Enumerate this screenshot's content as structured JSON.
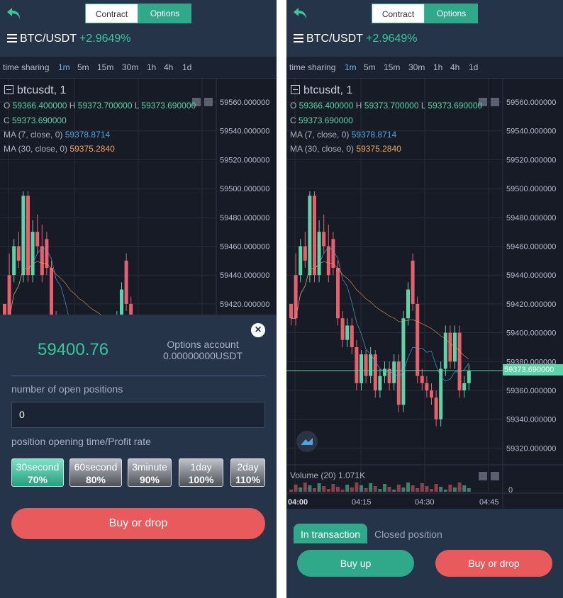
{
  "header": {
    "tabs": {
      "contract": "Contract",
      "options": "Options"
    },
    "pair": "BTC/USDT",
    "change": "+2.9649%"
  },
  "timeframes": [
    "time sharing",
    "1m",
    "5m",
    "15m",
    "30m",
    "1h",
    "4h",
    "1d"
  ],
  "chart": {
    "symbol": "btcusdt, 1",
    "ohlc": {
      "o": "59366.400000",
      "h": "59373.700000",
      "l": "59373.690000",
      "c": "59373.690000"
    },
    "ma7": {
      "label": "MA (7, close, 0)",
      "value": "59378.8714"
    },
    "ma30": {
      "label": "MA (30, close, 0)",
      "value": "59375.2840"
    },
    "price_labels": [
      "59560.000000",
      "59540.000000",
      "59520.000000",
      "59500.000000",
      "59480.000000",
      "59460.000000",
      "59440.000000",
      "59420.000000",
      "59400.000000",
      "59380.000000",
      "59360.000000",
      "59340.000000",
      "59320.000000"
    ],
    "current_price": "59373.690000",
    "volume": {
      "label": "Volume (20)",
      "value": "1.071K",
      "axis_zero": "0"
    },
    "time_labels": [
      "04:00",
      "04:15",
      "04:30",
      "04:45"
    ],
    "colors": {
      "up": "#5fd3a7",
      "down": "#e8606b",
      "bg": "#171b26",
      "grid": "#262c3a"
    },
    "candles": [
      [
        59420,
        59410,
        59415,
        59405
      ],
      [
        59440,
        59410,
        59455,
        59405
      ],
      [
        59440,
        59460,
        59465,
        59435
      ],
      [
        59460,
        59450,
        59470,
        59445
      ],
      [
        59440,
        59495,
        59498,
        59435
      ],
      [
        59495,
        59440,
        59498,
        59435
      ],
      [
        59440,
        59470,
        59478,
        59435
      ],
      [
        59470,
        59460,
        59482,
        59455
      ],
      [
        59460,
        59440,
        59475,
        59435
      ],
      [
        59465,
        59445,
        59470,
        59440
      ],
      [
        59445,
        59410,
        59450,
        59405
      ],
      [
        59410,
        59395,
        59415,
        59390
      ],
      [
        59395,
        59405,
        59410,
        59390
      ],
      [
        59405,
        59390,
        59410,
        59385
      ],
      [
        59390,
        59365,
        59395,
        59360
      ],
      [
        59365,
        59385,
        59388,
        59360
      ],
      [
        59385,
        59370,
        59388,
        59365
      ],
      [
        59370,
        59385,
        59390,
        59365
      ],
      [
        59385,
        59360,
        59388,
        59355
      ],
      [
        59360,
        59370,
        59375,
        59355
      ],
      [
        59370,
        59375,
        59380,
        59365
      ],
      [
        59375,
        59365,
        59380,
        59360
      ],
      [
        59365,
        59380,
        59385,
        59360
      ],
      [
        59380,
        59350,
        59385,
        59345
      ],
      [
        59350,
        59410,
        59415,
        59345
      ],
      [
        59410,
        59430,
        59435,
        59405
      ],
      [
        59450,
        59420,
        59455,
        59415
      ],
      [
        59420,
        59370,
        59425,
        59365
      ],
      [
        59370,
        59365,
        59375,
        59360
      ],
      [
        59365,
        59360,
        59370,
        59355
      ],
      [
        59360,
        59355,
        59365,
        59350
      ],
      [
        59355,
        59340,
        59360,
        59335
      ],
      [
        59340,
        59375,
        59380,
        59335
      ],
      [
        59375,
        59400,
        59405,
        59370
      ],
      [
        59400,
        59380,
        59405,
        59375
      ],
      [
        59380,
        59400,
        59405,
        59375
      ],
      [
        59400,
        59360,
        59405,
        59355
      ],
      [
        59360,
        59365,
        59370,
        59355
      ],
      [
        59365,
        59373.69,
        59378,
        59360
      ]
    ]
  },
  "left_sheet": {
    "price": "59400.76",
    "account_label": "Options account",
    "account_value": "0.00000000USDT",
    "positions_label": "number of open positions",
    "positions_value": "0",
    "time_label": "position opening time/Profit rate",
    "options": [
      {
        "time": "30second",
        "rate": "70%"
      },
      {
        "time": "60second",
        "rate": "80%"
      },
      {
        "time": "3minute",
        "rate": "90%"
      },
      {
        "time": "1day",
        "rate": "100%"
      },
      {
        "time": "2day",
        "rate": "110%"
      }
    ],
    "buy_drop": "Buy or drop"
  },
  "right_bottom": {
    "tab_in": "In transaction",
    "tab_closed": "Closed position",
    "buy_up": "Buy up",
    "buy_drop": "Buy or drop"
  }
}
